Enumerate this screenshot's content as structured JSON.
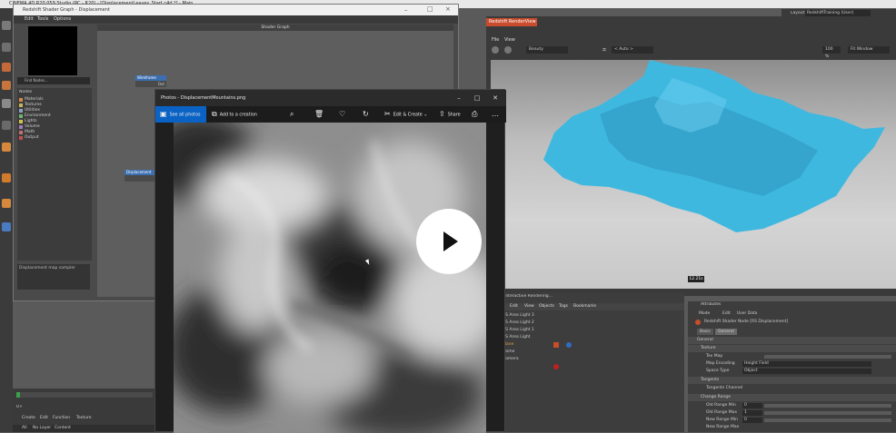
{
  "c4d": {
    "title": "CINEMA 4D R20.059 Studio (RC - R20) - [DisplacementLeaves_Start.c4d *] - Main",
    "layout_label": "Layout:",
    "layout_value": "RedshiftTraining (User)"
  },
  "shader_graph": {
    "title": "Redshift Shader Graph - Displacement",
    "menu": [
      "Edit",
      "Tools",
      "Options"
    ],
    "find_nodes": "Find Nodes...",
    "nodes_header": "Nodes",
    "categories": [
      {
        "label": "Materials",
        "color": "#d08a4a"
      },
      {
        "label": "Textures",
        "color": "#c9b457"
      },
      {
        "label": "Utilities",
        "color": "#8aa0c0"
      },
      {
        "label": "Environment",
        "color": "#6fb36f"
      },
      {
        "label": "Lights",
        "color": "#d0c24a"
      },
      {
        "label": "Volume",
        "color": "#a07ac0"
      },
      {
        "label": "Math",
        "color": "#c07070"
      },
      {
        "label": "Output",
        "color": "#c05050"
      }
    ],
    "description": "Displacement map sampler",
    "canvas_title": "Shader Graph",
    "node_wireframe": "Wireframe",
    "node_wireframe_port": "Out",
    "node_displacement": "Displacement"
  },
  "render_view": {
    "title": "Redshift RenderView",
    "menu": [
      "File",
      "View"
    ],
    "aov": "Beauty",
    "auto": "< Auto >",
    "zoom": "100 %",
    "fit": "Fit Window",
    "time": "12.21s",
    "mesh_color": "#3fb8e0"
  },
  "photos": {
    "title": "Photos - DisplacementMountains.png",
    "see_all": "See all photos",
    "add_creation": "Add to a creation",
    "edit_create": "Edit & Create",
    "share": "Share"
  },
  "objects": {
    "title": "Interactive Rendering...",
    "menu": [
      "Edit",
      "View",
      "Objects",
      "Tags",
      "Bookmarks"
    ],
    "rows": [
      "RS Area Light 3",
      "RS Area Light 2",
      "RS Area Light 1",
      "RS Area Light",
      "Plane",
      "Dome",
      "Camera"
    ]
  },
  "attributes": {
    "title": "Attributes",
    "menu": [
      "Mode",
      "Edit",
      "User Data"
    ],
    "node_name": "Redshift Shader Node [RS Displacement]",
    "tabs": [
      "Basic",
      "General"
    ],
    "general": "General",
    "texture_section": "Texture",
    "tex_map": "Tex Map",
    "map_encoding": "Map Encoding",
    "map_encoding_value": "Height Field",
    "space_type": "Space Type",
    "space_type_value": "Object",
    "tangents_section": "Tangents",
    "tangents_channel": "Tangents Channel",
    "range_section": "Change Range",
    "old_min": "Old Range Min",
    "old_min_value": "0",
    "old_max": "Old Range Max",
    "old_max_value": "1",
    "new_min": "New Range Min",
    "new_min_value": "0",
    "new_max": "New Range Max"
  },
  "timeline": {
    "frame": "0 F",
    "menu": [
      "Create",
      "Edit",
      "Function",
      "Texture"
    ],
    "tab_all": "All",
    "tab_no_layer": "No Layer",
    "tab_content": "Content"
  }
}
